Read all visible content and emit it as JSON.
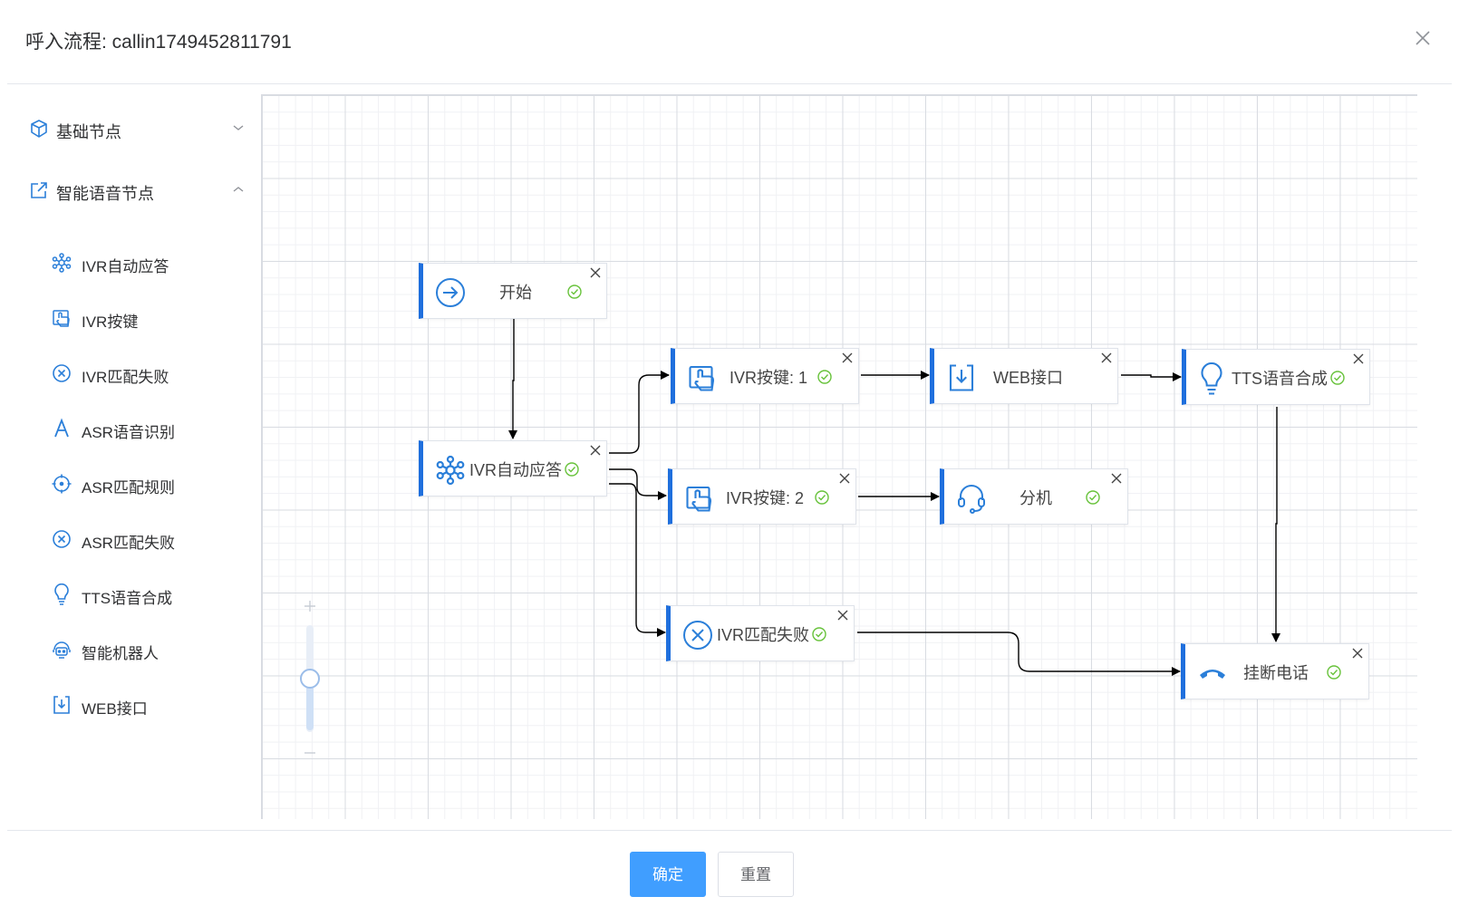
{
  "dialog": {
    "title": "呼入流程: callin1749452811791"
  },
  "sidebar": {
    "groups": [
      {
        "label": "基础节点",
        "icon": "cube-icon",
        "expanded": false
      },
      {
        "label": "智能语音节点",
        "icon": "edit-external-icon",
        "expanded": true
      }
    ],
    "items": [
      {
        "label": "IVR自动应答",
        "icon": "network-hub-icon"
      },
      {
        "label": "IVR按键",
        "icon": "hand-touch-icon"
      },
      {
        "label": "IVR匹配失败",
        "icon": "circle-x-icon"
      },
      {
        "label": "ASR语音识别",
        "icon": "letter-a-icon"
      },
      {
        "label": "ASR匹配规则",
        "icon": "crosshair-icon"
      },
      {
        "label": "ASR匹配失败",
        "icon": "circle-x-icon"
      },
      {
        "label": "TTS语音合成",
        "icon": "lightbulb-icon"
      },
      {
        "label": "智能机器人",
        "icon": "robot-icon"
      },
      {
        "label": "WEB接口",
        "icon": "download-box-icon"
      }
    ]
  },
  "flow": {
    "nodes": {
      "start": {
        "label": "开始",
        "icon": "arrow-circle-icon"
      },
      "ivr_auto": {
        "label": "IVR自动应答",
        "icon": "network-hub-icon"
      },
      "ivr_key1": {
        "label": "IVR按键: 1",
        "icon": "hand-touch-icon"
      },
      "ivr_key2": {
        "label": "IVR按键: 2",
        "icon": "hand-touch-icon"
      },
      "ivr_fail": {
        "label": "IVR匹配失败",
        "icon": "circle-x-icon"
      },
      "web": {
        "label": "WEB接口",
        "icon": "download-box-icon"
      },
      "ext": {
        "label": "分机",
        "icon": "headset-icon"
      },
      "tts": {
        "label": "TTS语音合成",
        "icon": "lightbulb-icon"
      },
      "hangup": {
        "label": "挂断电话",
        "icon": "hangup-phone-icon"
      }
    },
    "edges": [
      [
        "start",
        "ivr_auto"
      ],
      [
        "ivr_auto",
        "ivr_key1"
      ],
      [
        "ivr_auto",
        "ivr_key2"
      ],
      [
        "ivr_auto",
        "ivr_fail"
      ],
      [
        "ivr_key1",
        "web"
      ],
      [
        "web",
        "tts"
      ],
      [
        "ivr_key2",
        "ext"
      ],
      [
        "tts",
        "hangup"
      ],
      [
        "ivr_fail",
        "hangup"
      ]
    ]
  },
  "zoom": {
    "level": 0.5
  },
  "footer": {
    "confirm_label": "确定",
    "reset_label": "重置"
  },
  "colors": {
    "accent": "#1f6fdd",
    "icon": "#2b7fd9",
    "check": "#67c23a",
    "primary_button": "#409eff"
  }
}
